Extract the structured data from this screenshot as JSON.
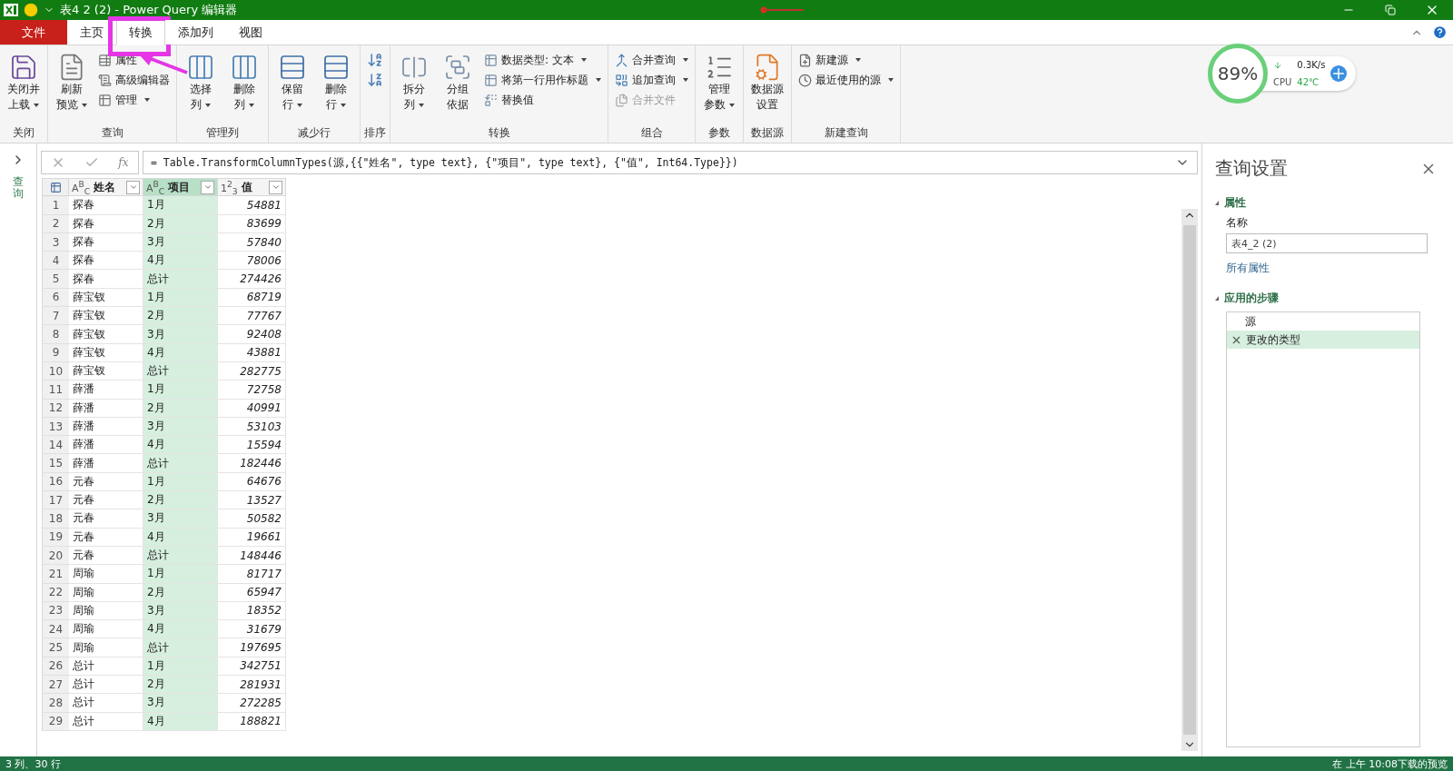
{
  "title_bar": {
    "title": "表4 2 (2) - Power Query 编辑器"
  },
  "tabs": [
    {
      "label": "文件",
      "kind": "file",
      "selected": false,
      "annotated": false
    },
    {
      "label": "主页",
      "kind": "tab",
      "selected": false,
      "annotated": false
    },
    {
      "label": "转换",
      "kind": "tab",
      "selected": true,
      "annotated": true
    },
    {
      "label": "添加列",
      "kind": "tab",
      "selected": false,
      "annotated": false
    },
    {
      "label": "视图",
      "kind": "tab",
      "selected": false,
      "annotated": false
    }
  ],
  "ribbon": {
    "groups": [
      {
        "label": "关闭",
        "items": [
          {
            "kind": "large",
            "lines": [
              "关闭并",
              "上载"
            ],
            "dropdown": true,
            "disabled": false
          }
        ]
      },
      {
        "label": "查询",
        "items": [
          {
            "kind": "large",
            "lines": [
              "刷新",
              "预览"
            ],
            "dropdown": true,
            "disabled": false
          },
          {
            "kind": "small",
            "lines": [
              "属性"
            ],
            "dropdown": false,
            "disabled": false
          },
          {
            "kind": "small",
            "lines": [
              "高级编辑器"
            ],
            "dropdown": false,
            "disabled": false
          },
          {
            "kind": "small",
            "lines": [
              "管理"
            ],
            "dropdown": true,
            "disabled": false
          }
        ]
      },
      {
        "label": "管理列",
        "items": [
          {
            "kind": "large",
            "lines": [
              "选择",
              "列"
            ],
            "dropdown": true,
            "disabled": false
          },
          {
            "kind": "large",
            "lines": [
              "删除",
              "列"
            ],
            "dropdown": true,
            "disabled": false
          }
        ]
      },
      {
        "label": "减少行",
        "items": [
          {
            "kind": "large",
            "lines": [
              "保留",
              "行"
            ],
            "dropdown": true,
            "disabled": false
          },
          {
            "kind": "large",
            "lines": [
              "删除",
              "行"
            ],
            "dropdown": true,
            "disabled": false
          }
        ]
      },
      {
        "label": "排序",
        "items": [
          {
            "kind": "icon",
            "dropdown": false,
            "disabled": false
          },
          {
            "kind": "icon",
            "dropdown": false,
            "disabled": false
          }
        ]
      },
      {
        "label": "转换",
        "items": [
          {
            "kind": "large",
            "lines": [
              "拆分",
              "列"
            ],
            "dropdown": true,
            "disabled": false
          },
          {
            "kind": "large",
            "lines": [
              "分组",
              "依据"
            ],
            "dropdown": false,
            "disabled": false
          },
          {
            "kind": "small",
            "lines": [
              "数据类型: 文本"
            ],
            "dropdown": true,
            "disabled": false
          },
          {
            "kind": "small",
            "lines": [
              "将第一行用作标题"
            ],
            "dropdown": true,
            "disabled": false
          },
          {
            "kind": "small",
            "lines": [
              "替换值"
            ],
            "dropdown": false,
            "disabled": false
          }
        ]
      },
      {
        "label": "组合",
        "items": [
          {
            "kind": "small",
            "lines": [
              "合并查询"
            ],
            "dropdown": true,
            "disabled": false
          },
          {
            "kind": "small",
            "lines": [
              "追加查询"
            ],
            "dropdown": true,
            "disabled": false
          },
          {
            "kind": "small",
            "lines": [
              "合并文件"
            ],
            "dropdown": false,
            "disabled": true
          }
        ]
      },
      {
        "label": "参数",
        "items": [
          {
            "kind": "large",
            "lines": [
              "管理",
              "参数"
            ],
            "dropdown": true,
            "disabled": false
          }
        ]
      },
      {
        "label": "数据源",
        "items": [
          {
            "kind": "large",
            "lines": [
              "数据源",
              "设置"
            ],
            "dropdown": false,
            "disabled": false
          }
        ]
      },
      {
        "label": "新建查询",
        "items": [
          {
            "kind": "small",
            "lines": [
              "新建源"
            ],
            "dropdown": true,
            "disabled": false
          },
          {
            "kind": "small",
            "lines": [
              "最近使用的源"
            ],
            "dropdown": true,
            "disabled": false
          }
        ]
      }
    ]
  },
  "monitor": {
    "percent": "89%",
    "speed": "0.3K/s",
    "cpu_label": "CPU",
    "temperature": "42℃"
  },
  "queries_pane": {
    "label": "查询"
  },
  "formula_bar": {
    "fx": "fx",
    "formula": "= Table.TransformColumnTypes(源,{{\"姓名\", type text}, {\"项目\", type text}, {\"值\", Int64.Type}})"
  },
  "table": {
    "columns": [
      {
        "kind": "text",
        "type_label": "A$^{B}$$_{C}$",
        "name": "姓名",
        "selected": false
      },
      {
        "kind": "text",
        "type_label": "A$^{B}$$_{C}$",
        "name": "项目",
        "selected": true
      },
      {
        "kind": "number",
        "type_label": "1$^{2}$$_{3}$",
        "name": "值",
        "selected": false
      }
    ],
    "rows": [
      {
        "n": "1",
        "cells": [
          "探春",
          "1月",
          "54881"
        ]
      },
      {
        "n": "2",
        "cells": [
          "探春",
          "2月",
          "83699"
        ]
      },
      {
        "n": "3",
        "cells": [
          "探春",
          "3月",
          "57840"
        ]
      },
      {
        "n": "4",
        "cells": [
          "探春",
          "4月",
          "78006"
        ]
      },
      {
        "n": "5",
        "cells": [
          "探春",
          "总计",
          "274426"
        ]
      },
      {
        "n": "6",
        "cells": [
          "薛宝钗",
          "1月",
          "68719"
        ]
      },
      {
        "n": "7",
        "cells": [
          "薛宝钗",
          "2月",
          "77767"
        ]
      },
      {
        "n": "8",
        "cells": [
          "薛宝钗",
          "3月",
          "92408"
        ]
      },
      {
        "n": "9",
        "cells": [
          "薛宝钗",
          "4月",
          "43881"
        ]
      },
      {
        "n": "10",
        "cells": [
          "薛宝钗",
          "总计",
          "282775"
        ]
      },
      {
        "n": "11",
        "cells": [
          "薛潘",
          "1月",
          "72758"
        ]
      },
      {
        "n": "12",
        "cells": [
          "薛潘",
          "2月",
          "40991"
        ]
      },
      {
        "n": "13",
        "cells": [
          "薛潘",
          "3月",
          "53103"
        ]
      },
      {
        "n": "14",
        "cells": [
          "薛潘",
          "4月",
          "15594"
        ]
      },
      {
        "n": "15",
        "cells": [
          "薛潘",
          "总计",
          "182446"
        ]
      },
      {
        "n": "16",
        "cells": [
          "元春",
          "1月",
          "64676"
        ]
      },
      {
        "n": "17",
        "cells": [
          "元春",
          "2月",
          "13527"
        ]
      },
      {
        "n": "18",
        "cells": [
          "元春",
          "3月",
          "50582"
        ]
      },
      {
        "n": "19",
        "cells": [
          "元春",
          "4月",
          "19661"
        ]
      },
      {
        "n": "20",
        "cells": [
          "元春",
          "总计",
          "148446"
        ]
      },
      {
        "n": "21",
        "cells": [
          "周瑜",
          "1月",
          "81717"
        ]
      },
      {
        "n": "22",
        "cells": [
          "周瑜",
          "2月",
          "65947"
        ]
      },
      {
        "n": "23",
        "cells": [
          "周瑜",
          "3月",
          "18352"
        ]
      },
      {
        "n": "24",
        "cells": [
          "周瑜",
          "4月",
          "31679"
        ]
      },
      {
        "n": "25",
        "cells": [
          "周瑜",
          "总计",
          "197695"
        ]
      },
      {
        "n": "26",
        "cells": [
          "总计",
          "1月",
          "342751"
        ]
      },
      {
        "n": "27",
        "cells": [
          "总计",
          "2月",
          "281931"
        ]
      },
      {
        "n": "28",
        "cells": [
          "总计",
          "3月",
          "272285"
        ]
      },
      {
        "n": "29",
        "cells": [
          "总计",
          "4月",
          "188821"
        ]
      }
    ]
  },
  "settings": {
    "title": "查询设置",
    "properties": {
      "heading": "属性",
      "name_label": "名称",
      "name_value": "表4_2 (2)",
      "all_link": "所有属性"
    },
    "steps_heading": "应用的步骤",
    "steps": [
      {
        "label": "源",
        "selected": false
      },
      {
        "label": "更改的类型",
        "selected": true
      }
    ]
  },
  "status_bar": {
    "left": "3 列、30 行",
    "right": "在 上午 10:08下载的预览"
  }
}
